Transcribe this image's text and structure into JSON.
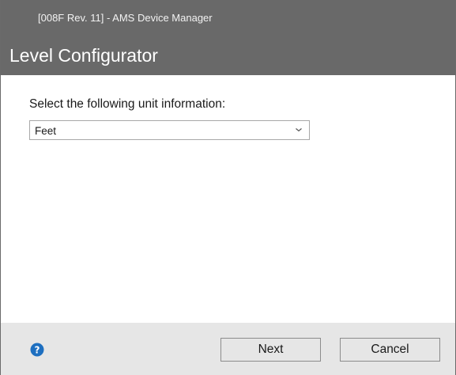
{
  "window": {
    "title": "[008F Rev. 11] - AMS Device Manager"
  },
  "dialog": {
    "title": "Level Configurator",
    "prompt": "Select the following unit information:"
  },
  "unit_select": {
    "selected_value": "Feet",
    "icon": "chevron-down-icon"
  },
  "footer": {
    "help_icon": "help-icon",
    "next_label": "Next",
    "cancel_label": "Cancel"
  },
  "colors": {
    "header_bg": "#696969",
    "footer_bg": "#e6e6e6",
    "help_icon": "#1e6fc0"
  }
}
